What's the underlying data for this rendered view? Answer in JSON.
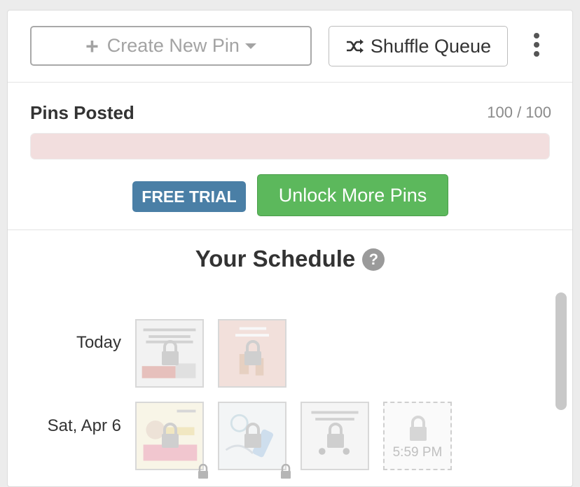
{
  "toolbar": {
    "create_label": "Create New Pin",
    "shuffle_label": "Shuffle Queue"
  },
  "pins_posted": {
    "label": "Pins Posted",
    "count_text": "100 / 100",
    "progress_fraction": 1.0
  },
  "plan": {
    "trial_badge": "FREE TRIAL",
    "unlock_label": "Unlock More Pins"
  },
  "schedule": {
    "title": "Your Schedule",
    "help_icon_text": "?",
    "days": [
      {
        "label": "Today"
      },
      {
        "label": "Sat, Apr 6",
        "empty_slot_time": "5:59 PM"
      }
    ]
  },
  "colors": {
    "trial": "#4a7fa6",
    "unlock": "#5cb85c",
    "progress_bg": "#f2dede"
  },
  "icons": [
    "plus-icon",
    "caret-down-icon",
    "shuffle-icon",
    "more-vertical-icon",
    "question-icon",
    "lock-icon"
  ]
}
